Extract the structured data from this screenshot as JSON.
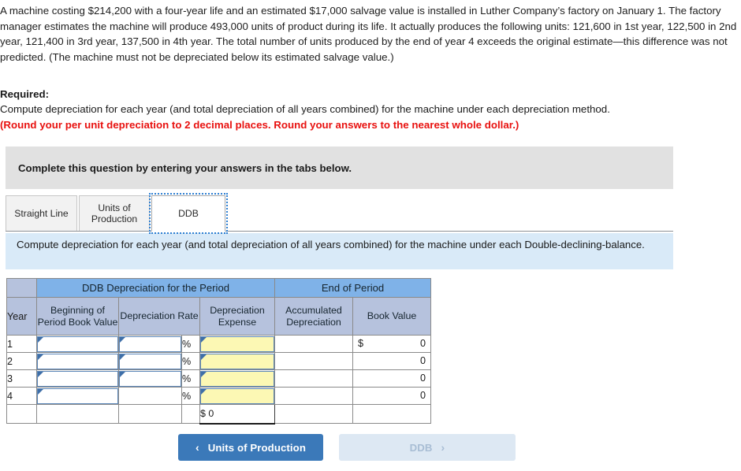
{
  "problem": {
    "text": "A machine costing $214,200 with a four-year life and an estimated $17,000 salvage value is installed in Luther Company’s factory on January 1. The factory manager estimates the machine will produce 493,000 units of product during its life. It actually produces the following units: 121,600 in 1st year, 122,500 in 2nd year, 121,400 in 3rd year, 137,500 in 4th year. The total number of units produced by the end of year 4 exceeds the original estimate—this difference was not predicted. (The machine must not be depreciated below its estimated salvage value.)"
  },
  "required": {
    "title": "Required:",
    "text": "Compute depreciation for each year (and total depreciation of all years combined) for the machine under each depreciation method.",
    "rounding_note": "(Round your per unit depreciation to 2 decimal places. Round your answers to the nearest whole dollar.)"
  },
  "instruction_panel": {
    "text": "Complete this question by entering your answers in the tabs below."
  },
  "tabs": [
    {
      "label": "Straight Line",
      "active": false
    },
    {
      "label": "Units of Production",
      "active": false
    },
    {
      "label": "DDB",
      "active": true
    }
  ],
  "info_band": {
    "text": "Compute depreciation for each year (and total depreciation of all years combined) for the machine under each Double-declining-balance."
  },
  "table": {
    "group_headers": [
      {
        "label": "",
        "span": 1
      },
      {
        "label": "DDB Depreciation for the Period",
        "span": 3
      },
      {
        "label": "End of Period",
        "span": 2
      }
    ],
    "column_headers": [
      "Year",
      "Beginning of Period Book Value",
      "Depreciation Rate",
      "Depreciation Expense",
      "Accumulated Depreciation",
      "Book Value"
    ],
    "percent_symbol": "%",
    "dollar_symbol": "$",
    "rows": [
      {
        "year": "1",
        "beginning_book_value": "",
        "depreciation_rate": "",
        "depreciation_expense": "",
        "accumulated_depreciation": "",
        "book_value": "0",
        "book_value_dollar": "$"
      },
      {
        "year": "2",
        "beginning_book_value": "",
        "depreciation_rate": "",
        "depreciation_expense": "",
        "accumulated_depreciation": "",
        "book_value": "0",
        "book_value_dollar": ""
      },
      {
        "year": "3",
        "beginning_book_value": "",
        "depreciation_rate": "",
        "depreciation_expense": "",
        "accumulated_depreciation": "",
        "book_value": "0",
        "book_value_dollar": ""
      },
      {
        "year": "4",
        "beginning_book_value": "",
        "depreciation_rate": "",
        "depreciation_expense": "",
        "accumulated_depreciation": "",
        "book_value": "0",
        "book_value_dollar": ""
      }
    ],
    "total_row": {
      "dollar_symbol": "$",
      "total_depreciation_expense": "0"
    }
  },
  "nav": {
    "prev_label": "Units of Production",
    "prev_chevron": "‹",
    "next_label": "DDB",
    "next_chevron": "›"
  },
  "colors": {
    "accent_blue": "#3b79b9",
    "header_blue": "#7fb2e8",
    "subheader_lavender": "#b6c2dd",
    "info_band_blue": "#d9eaf8",
    "panel_gray": "#e1e1e1",
    "input_yellow": "#fcf8b4",
    "input_border": "#5b86b8",
    "required_red": "#e8110f",
    "next_button_bg": "#dde8f3"
  }
}
